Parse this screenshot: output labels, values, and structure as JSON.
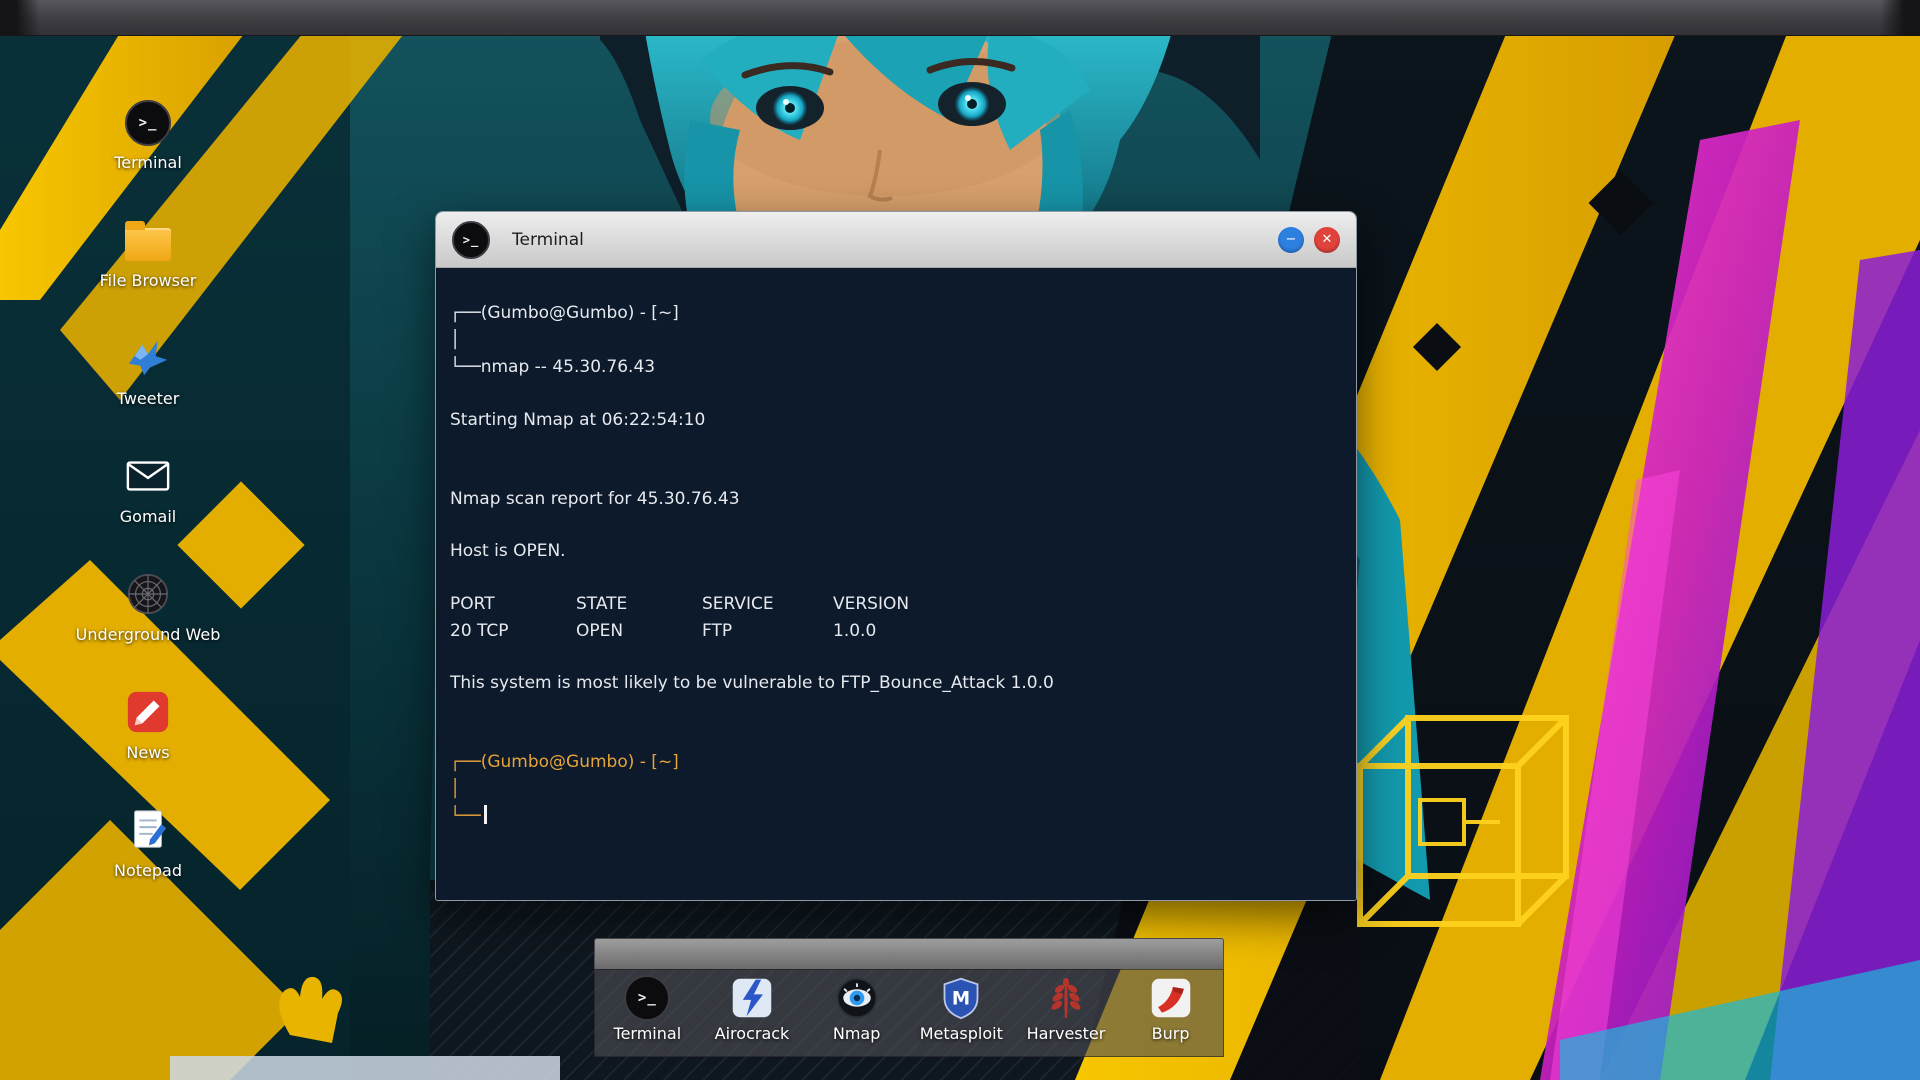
{
  "colors": {
    "accent_yellow": "#e8b400",
    "accent_magenta": "#c81fc0",
    "accent_cyan": "#2fd3e8",
    "terminal_bg": "#0c1a2b",
    "terminal_text": "#e6e9ee",
    "prompt_highlight": "#e8a33a",
    "titlebar_bg": "#d9d9d9",
    "minimize_button": "#2d7fe0",
    "close_button": "#e0433c",
    "dock_bg": "rgba(78,78,84,0.62)"
  },
  "glyphs": {
    "terminal_prompt": ">_",
    "minimize": "−",
    "close": "✕",
    "metasploit_m": "M"
  },
  "desktop": {
    "icons": [
      {
        "label": "Terminal",
        "icon": "terminal-icon"
      },
      {
        "label": "File Browser",
        "icon": "folder-icon"
      },
      {
        "label": "Tweeter",
        "icon": "bird-icon"
      },
      {
        "label": "Gomail",
        "icon": "envelope-icon"
      },
      {
        "label": "Underground Web",
        "icon": "dark-web-icon"
      },
      {
        "label": "News",
        "icon": "news-icon"
      },
      {
        "label": "Notepad",
        "icon": "notepad-icon"
      }
    ]
  },
  "window": {
    "title": "Terminal"
  },
  "terminal": {
    "prompt1": {
      "top": "┌──(Gumbo@Gumbo) - [~]",
      "mid": "│",
      "bottom_prefix": "└──",
      "command": "nmap -- 45.30.76.43"
    },
    "lines": {
      "starting": "Starting Nmap at 06:22:54:10",
      "report": "Nmap scan report for 45.30.76.43",
      "host": "Host is OPEN."
    },
    "table": {
      "headers": [
        "PORT",
        "STATE",
        "SERVICE",
        "VERSION"
      ],
      "row": [
        "20 TCP",
        "OPEN",
        "FTP",
        "1.0.0"
      ]
    },
    "vulnerability": "This system is most likely to be vulnerable to FTP_Bounce_Attack 1.0.0",
    "prompt2": {
      "top": "┌──(Gumbo@Gumbo) - [~]",
      "mid": "│",
      "bottom_prefix": "└──"
    }
  },
  "dock": {
    "items": [
      {
        "label": "Terminal",
        "icon": "terminal-icon"
      },
      {
        "label": "Airocrack",
        "icon": "aircrack-icon"
      },
      {
        "label": "Nmap",
        "icon": "nmap-eye-icon"
      },
      {
        "label": "Metasploit",
        "icon": "metasploit-shield-icon"
      },
      {
        "label": "Harvester",
        "icon": "harvester-plant-icon"
      },
      {
        "label": "Burp",
        "icon": "burp-icon"
      }
    ]
  }
}
